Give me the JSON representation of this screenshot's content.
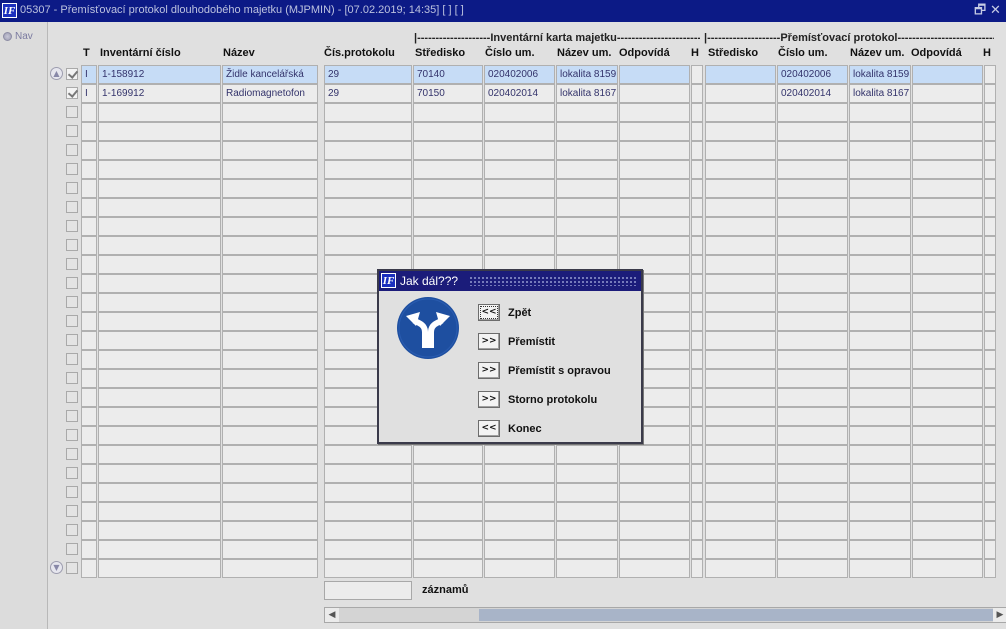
{
  "window": {
    "title": "05307 - Přemísťovací protokol dlouhodobého majetku (MJPMIN) - [07.02.2019; 14:35]  [ ]  [ ]",
    "restore_glyph": "🗗",
    "close_glyph": "✕",
    "app_icon_text": "IF"
  },
  "nav": {
    "label": "Nav"
  },
  "groups": {
    "karta": "|--------------------Inventární karta majetku---------------------------|",
    "protokol": "|--------------------Přemísťovací protokol-------------------------------|"
  },
  "columns": [
    "T",
    "Inventární číslo",
    "Název",
    "Čís.protokolu",
    "Středisko",
    "Číslo um.",
    "Název um.",
    "Odpovídá",
    "H",
    "Středisko",
    "Číslo um.",
    "Název um.",
    "Odpovídá",
    "H"
  ],
  "rows": [
    {
      "checked": true,
      "t": "I",
      "inv": "1-158912",
      "nazev": "Židle kancelářská",
      "protokol": "29",
      "stredisko": "70140",
      "cislo_um": "020402006",
      "nazev_um": "lokalita 8159",
      "odpovida": "",
      "h": "",
      "p_stredisko": "",
      "p_cislo_um": "020402006",
      "p_nazev_um": "lokalita 8159",
      "p_odpovida": "",
      "p_h": ""
    },
    {
      "checked": true,
      "t": "I",
      "inv": "1-169912",
      "nazev": "Radiomagnetofon",
      "protokol": "29",
      "stredisko": "70150",
      "cislo_um": "020402014",
      "nazev_um": "lokalita 8167",
      "odpovida": "",
      "h": "",
      "p_stredisko": "",
      "p_cislo_um": "020402014",
      "p_nazev_um": "lokalita 8167",
      "p_odpovida": "",
      "p_h": ""
    }
  ],
  "empty_row_count": 25,
  "footer": {
    "count_value": "",
    "count_label": "záznamů"
  },
  "scroll": {
    "left_arrow": "◀",
    "right_arrow": "▶",
    "up_arrow": "▲",
    "down_arrow": "▼"
  },
  "dialog": {
    "title": "Jak dál???",
    "icon": "split-direction-sign-icon",
    "buttons": [
      {
        "symbol": "<<",
        "label": "Zpět"
      },
      {
        "symbol": ">>",
        "label": "Přemístit"
      },
      {
        "symbol": ">>",
        "label": "Přemístit s opravou"
      },
      {
        "symbol": ">>",
        "label": "Storno protokolu"
      },
      {
        "symbol": "<<",
        "label": "Konec"
      }
    ]
  },
  "colors": {
    "title_bar": "#0c1a86",
    "dialog_title": "#1b1c7a",
    "selection": "#c6dcf6",
    "sign_blue": "#1e4fa0"
  }
}
